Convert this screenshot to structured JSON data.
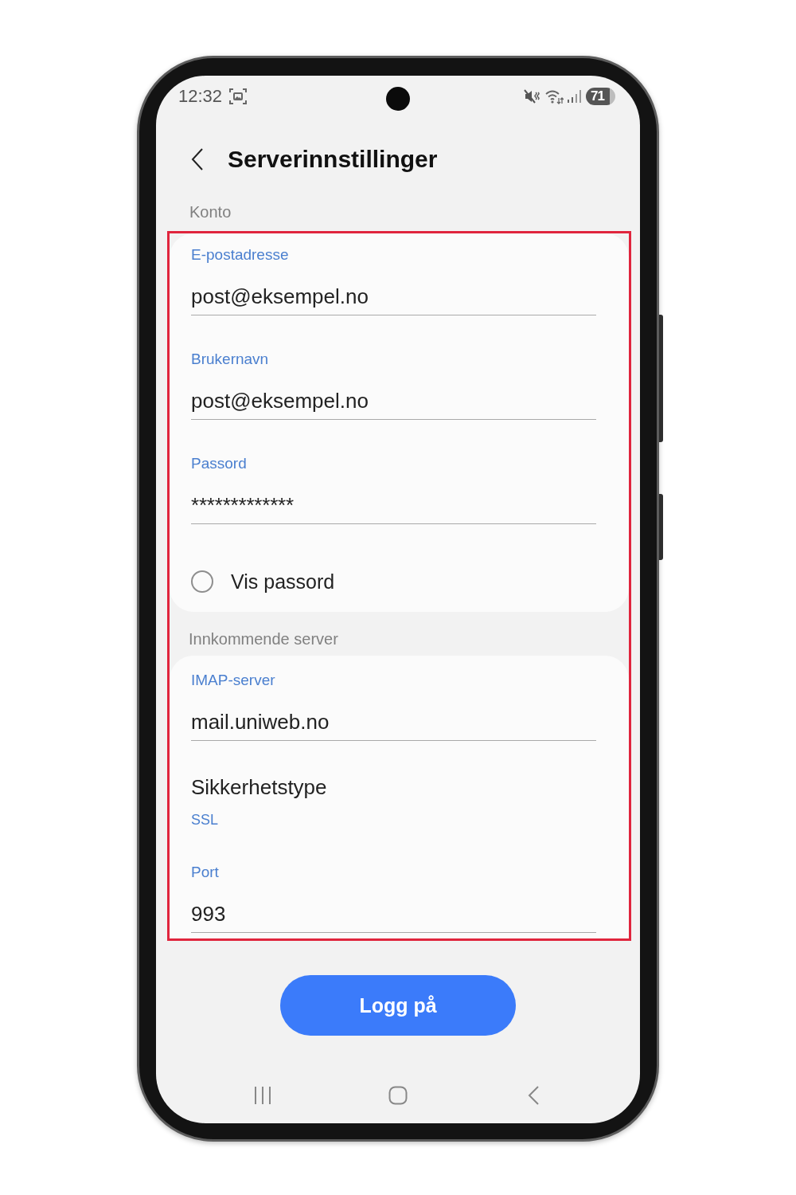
{
  "status_bar": {
    "time": "12:32",
    "battery": "71"
  },
  "header": {
    "title": "Serverinnstillinger"
  },
  "account_heading": "Konto",
  "form": {
    "highlighted": true,
    "account_fields": [
      {
        "kind": "text",
        "label": "E-postadresse",
        "value": "post@eksempel.no"
      },
      {
        "kind": "text",
        "label": "Brukernavn",
        "value": "post@eksempel.no"
      },
      {
        "kind": "password",
        "label": "Passord",
        "value": "*************"
      },
      {
        "kind": "checkbox",
        "label": "Vis passord",
        "checked": false
      }
    ],
    "incoming_heading": "Innkommende server",
    "incoming_fields": [
      {
        "kind": "text",
        "label": "IMAP-server",
        "value": "mail.uniweb.no"
      },
      {
        "kind": "option",
        "label": "Sikkerhetstype",
        "value": "SSL"
      },
      {
        "kind": "text",
        "label": "Port",
        "value": "993"
      }
    ]
  },
  "login_button": {
    "label": "Logg på"
  }
}
